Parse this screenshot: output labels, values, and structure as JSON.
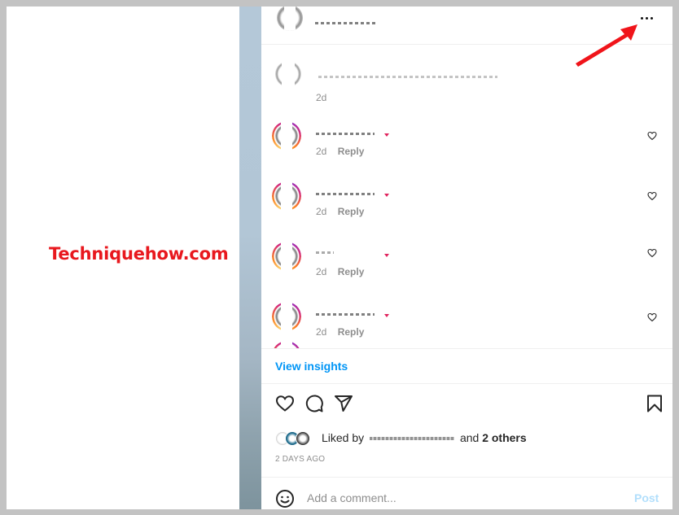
{
  "watermark": "Techniquehow.com",
  "post": {
    "header": {
      "username": "[redacted]",
      "more_options_label": "More options"
    },
    "comments": [
      {
        "avatar": "plain",
        "username": "[redacted]",
        "text": "[redacted]",
        "time": "2d",
        "reply_label": "",
        "has_like": false
      },
      {
        "avatar": "story-ring",
        "username": "[redacted]",
        "text": "❤",
        "time": "2d",
        "reply_label": "Reply",
        "has_like": true
      },
      {
        "avatar": "story-ring",
        "username": "[redacted]",
        "text": "❤",
        "time": "2d",
        "reply_label": "Reply",
        "has_like": true
      },
      {
        "avatar": "story-ring",
        "username": "[redacted]",
        "text": "❤",
        "time": "2d",
        "reply_label": "Reply",
        "has_like": true
      },
      {
        "avatar": "story-ring",
        "username": "[redacted]",
        "text": "❤",
        "time": "2d",
        "reply_label": "Reply",
        "has_like": true
      }
    ],
    "view_insights_label": "View insights",
    "actions": {
      "like_icon": "heart-outline-icon",
      "comment_icon": "speech-bubble-icon",
      "share_icon": "paper-plane-icon",
      "save_icon": "bookmark-icon"
    },
    "likes": {
      "prefix": "Liked by",
      "liker_username": "[redacted]",
      "conjunction": "and",
      "others": "2 others"
    },
    "date": "2 DAYS AGO",
    "add_comment": {
      "placeholder": "Add a comment...",
      "value": "",
      "post_label": "Post"
    }
  },
  "colors": {
    "accent_link": "#0095f6",
    "post_disabled": "#b2dffc",
    "annotation_arrow": "#f0141a",
    "watermark": "#e8181e"
  }
}
